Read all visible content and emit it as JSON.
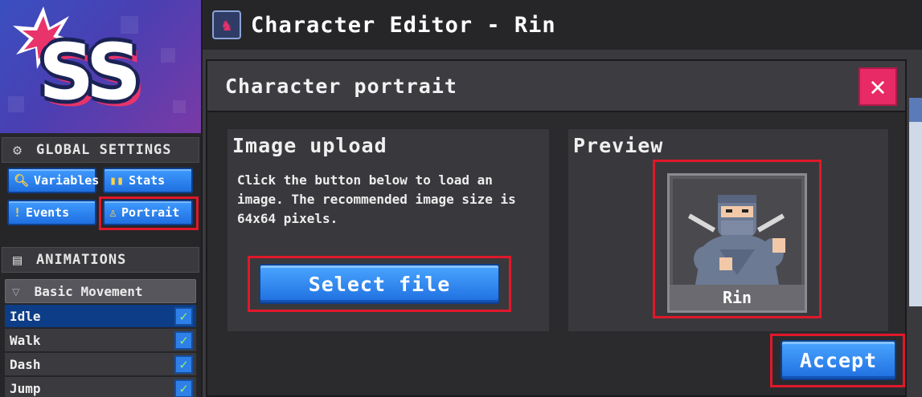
{
  "app": {
    "logo_text": "SS",
    "window_title": "Character Editor - Rin",
    "icon": "character-icon"
  },
  "sidebar": {
    "global_settings": {
      "label": "GLOBAL SETTINGS",
      "icon": "gear-icon"
    },
    "settings_buttons": [
      {
        "label": "Variables",
        "icon": "search-icon"
      },
      {
        "label": "Stats",
        "icon": "bar-chart-icon"
      },
      {
        "label": "Events",
        "icon": "exclamation-icon"
      },
      {
        "label": "Portrait",
        "icon": "portrait-icon",
        "highlighted": true
      }
    ],
    "animations": {
      "label": "ANIMATIONS",
      "icon": "film-icon"
    },
    "group": {
      "label": "Basic Movement",
      "icon": "funnel-icon"
    },
    "animation_items": [
      {
        "label": "Idle",
        "checked": true,
        "selected": true
      },
      {
        "label": "Walk",
        "checked": true,
        "selected": false
      },
      {
        "label": "Dash",
        "checked": true,
        "selected": false
      },
      {
        "label": "Jump",
        "checked": true,
        "selected": false
      }
    ]
  },
  "modal": {
    "title": "Character portrait",
    "close_icon": "close-icon",
    "upload": {
      "title": "Image upload",
      "description": "Click the button below to load an image. The recommended image size is 64x64 pixels.",
      "select_label": "Select file"
    },
    "preview": {
      "title": "Preview",
      "character_name": "Rin"
    },
    "accept_label": "Accept"
  },
  "colors": {
    "accent_blue": "#1f6fe0",
    "highlight_red": "#e0182a",
    "close_pink": "#e82a66",
    "check_green": "#8cf26b"
  }
}
